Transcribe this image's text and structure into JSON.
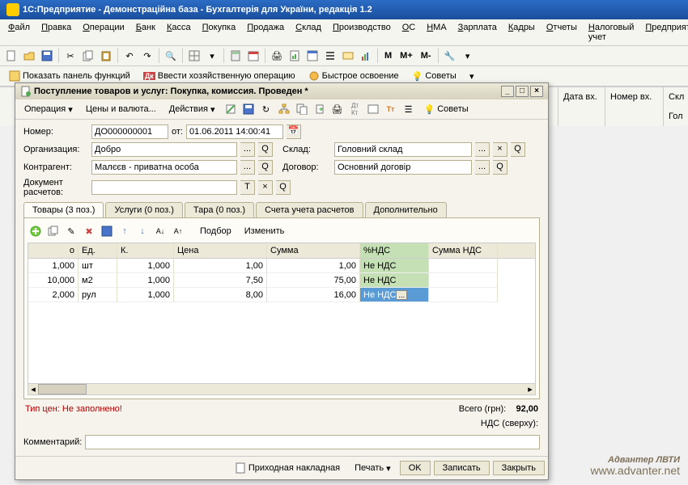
{
  "app": {
    "title": "1С:Предприятие - Демонстраційна база - Бухгалтерія для України, редакція 1.2"
  },
  "menubar": [
    "Файл",
    "Правка",
    "Операции",
    "Банк",
    "Касса",
    "Покупка",
    "Продажа",
    "Склад",
    "Производство",
    "ОС",
    "НМА",
    "Зарплата",
    "Кадры",
    "Отчеты",
    "Налоговый учет",
    "Предприятие"
  ],
  "toolbar2": {
    "show_panel": "Показать панель функций",
    "enter_op": "Ввести хозяйственную операцию",
    "fast_learn": "Быстрое освоение",
    "tips": "Советы"
  },
  "memo_m": [
    "M",
    "M+",
    "M-"
  ],
  "bg_cols": {
    "date_in": "Дата вх.",
    "num_in": "Номер вх.",
    "warehouse": "Скл"
  },
  "bg_row": {
    "warehouse": "Гол"
  },
  "dialog": {
    "title": "Поступление товаров и услуг: Покупка, комиссия. Проведен *",
    "menu": {
      "operation": "Операция",
      "prices": "Цены и валюта...",
      "actions": "Действия",
      "tips": "Советы"
    },
    "labels": {
      "number": "Номер:",
      "from": "от:",
      "org": "Организация:",
      "warehouse": "Склад:",
      "contractor": "Контрагент:",
      "contract": "Договор:",
      "doc_calc": "Документ расчетов:",
      "select": "Подбор",
      "change": "Изменить",
      "price_type": "Тип цен: Не заполнено!",
      "total": "Всего (грн):",
      "nds": "НДС (сверху):",
      "comment": "Комментарий:",
      "invoice": "Приходная накладная",
      "print": "Печать",
      "ok": "OK",
      "save": "Записать",
      "close": "Закрыть"
    },
    "fields": {
      "number": "ДО000000001",
      "date": "01.06.2011 14:00:41",
      "org": "Добро",
      "warehouse": "Головний склад",
      "contractor": "Малєєв - приватна особа",
      "contract": "Основний договір",
      "doc_calc": ""
    },
    "tabs": [
      "Товары (3 поз.)",
      "Услуги (0 поз.)",
      "Тара (0 поз.)",
      "Счета учета расчетов",
      "Дополнительно"
    ],
    "grid": {
      "headers": {
        "qty": "о",
        "unit": "Ед.",
        "k": "К.",
        "price": "Цена",
        "sum": "Сумма",
        "nds": "%НДС",
        "nds_sum": "Сумма НДС"
      },
      "rows": [
        {
          "qty": "1,000",
          "unit": "шт",
          "k": "1,000",
          "price": "1,00",
          "sum": "1,00",
          "nds": "Не НДС",
          "nds_sum": ""
        },
        {
          "qty": "10,000",
          "unit": "м2",
          "k": "1,000",
          "price": "7,50",
          "sum": "75,00",
          "nds": "Не НДС",
          "nds_sum": ""
        },
        {
          "qty": "2,000",
          "unit": "рул",
          "k": "1,000",
          "price": "8,00",
          "sum": "16,00",
          "nds": "Не НДС",
          "nds_sum": ""
        }
      ]
    },
    "totals": {
      "total": "92,00",
      "nds": ""
    }
  },
  "watermark": {
    "main": "Адвантер ЛВТИ",
    "sub": "www.advanter.net"
  }
}
